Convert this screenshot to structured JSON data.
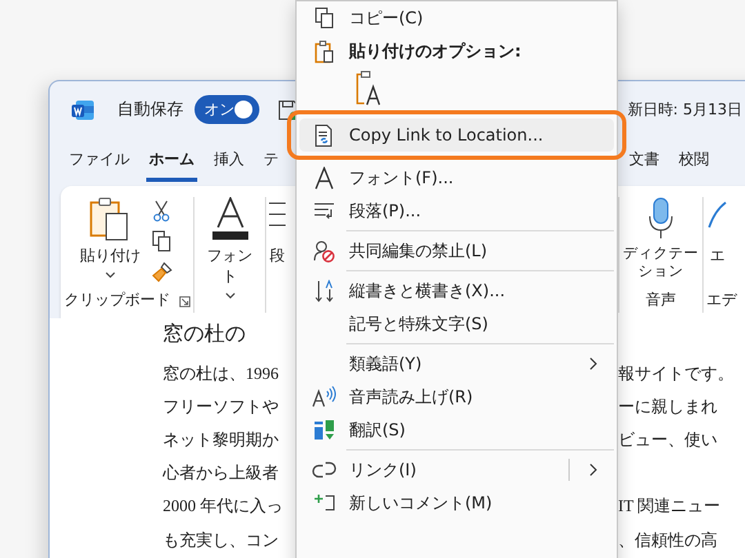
{
  "title_bar": {
    "autosave_label": "自動保存",
    "autosave_toggle": {
      "label": "オン",
      "on": true
    },
    "modified_text": "新日時: 5月13日"
  },
  "tabs": [
    {
      "label": "ファイル",
      "selected": false
    },
    {
      "label": "ホーム",
      "selected": true
    },
    {
      "label": "挿入",
      "selected": false
    },
    {
      "label": "テ",
      "selected": false
    },
    {
      "label": "文書",
      "selected": false
    },
    {
      "label": "校閲",
      "selected": false
    }
  ],
  "ribbon": {
    "clipboard": {
      "paste_label": "貼り付け",
      "group_label": "クリップボード"
    },
    "font": {
      "button_label": "フォント"
    },
    "paragraph": {
      "label": "段"
    },
    "voice": {
      "button_label": "ディクテーション",
      "group_label": "音声"
    },
    "editor": {
      "button_label": "エ",
      "group_label": "エデ"
    }
  },
  "document": {
    "heading": "窓の杜の",
    "lines": [
      {
        "left": "窓の杜は、1996",
        "right": "報サイトです。"
      },
      {
        "left": "フリーソフトや",
        "right": "ーに親しまれ"
      },
      {
        "left": "ネット黎明期か",
        "right": "ビュー、使い"
      },
      {
        "left": "心者から上級者"
      },
      {
        "left": "2000 年代に入っ",
        "right": "IT 関連ニュー"
      },
      {
        "left": "も充実し、コン",
        "right": "、信頼性の高"
      }
    ]
  },
  "context_menu": {
    "items": [
      {
        "kind": "item",
        "label": "コピー(C)",
        "submenu": false,
        "split": false,
        "highlighted": false
      },
      {
        "kind": "header",
        "label": "貼り付けのオプション:"
      },
      {
        "kind": "paste_options"
      },
      {
        "kind": "item",
        "label": "Copy Link to Location...",
        "submenu": false,
        "split": false,
        "highlighted": true
      },
      {
        "kind": "item",
        "label": "フォント(F)...",
        "submenu": false,
        "split": false,
        "highlighted": false
      },
      {
        "kind": "item",
        "label": "段落(P)...",
        "submenu": false,
        "split": false,
        "highlighted": false
      },
      {
        "kind": "separator"
      },
      {
        "kind": "item",
        "label": "共同編集の禁止(L)",
        "submenu": false,
        "split": false,
        "highlighted": false
      },
      {
        "kind": "separator"
      },
      {
        "kind": "item",
        "label": "縦書きと横書き(X)...",
        "submenu": false,
        "split": false,
        "highlighted": false
      },
      {
        "kind": "item",
        "label": "記号と特殊文字(S)",
        "submenu": false,
        "split": false,
        "highlighted": false
      },
      {
        "kind": "separator"
      },
      {
        "kind": "item",
        "label": "類義語(Y)",
        "submenu": true,
        "split": false,
        "highlighted": false
      },
      {
        "kind": "item",
        "label": "音声読み上げ(R)",
        "submenu": false,
        "split": false,
        "highlighted": false
      },
      {
        "kind": "item",
        "label": "翻訳(S)",
        "submenu": false,
        "split": false,
        "highlighted": false
      },
      {
        "kind": "separator"
      },
      {
        "kind": "item",
        "label": "リンク(I)",
        "submenu": true,
        "split": true,
        "highlighted": false
      },
      {
        "kind": "item",
        "label": "新しいコメント(M)",
        "submenu": false,
        "split": false,
        "highlighted": false
      }
    ]
  }
}
